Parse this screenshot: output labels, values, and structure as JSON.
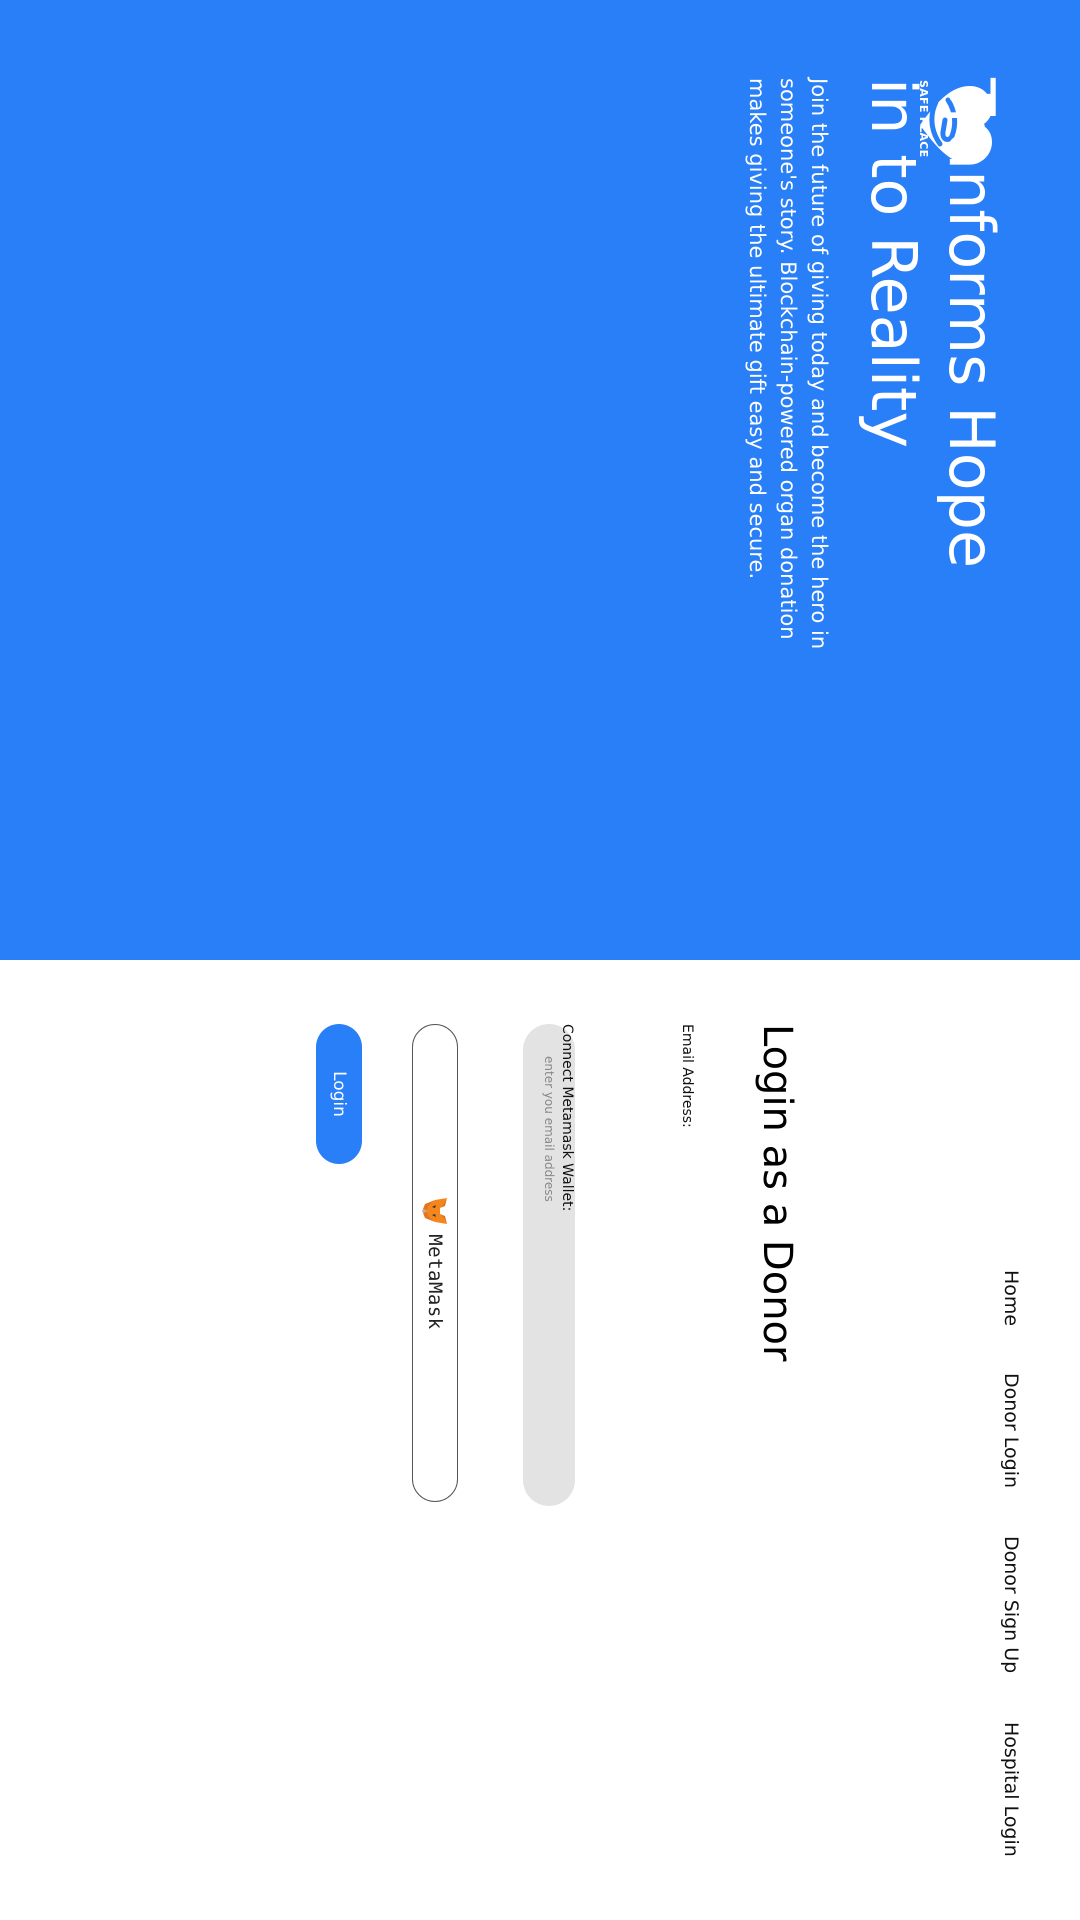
{
  "brand": {
    "name": "SAFE PLACE",
    "primary_color": "#287ff8"
  },
  "hero": {
    "title_line1": "Tranforms Hope",
    "title_line2": "in to Reality",
    "description": "Join the future of giving today and become the hero in someone's story. Blockchain-powered organ donation makes giving the ultimate gift easy and secure."
  },
  "nav": {
    "items": [
      {
        "label": "Home"
      },
      {
        "label": "Donor Login"
      },
      {
        "label": "Donor Sign Up"
      },
      {
        "label": "Hospital Login"
      }
    ]
  },
  "login": {
    "title": "Login as a Donor",
    "email_label": "Email Address:",
    "email_placeholder": "enter you email address",
    "email_value": "",
    "wallet_label": "Connect Metamask Wallet:",
    "metamask_label": "MetaMask",
    "metamask_icon": "fox-icon",
    "submit_label": "Login"
  }
}
